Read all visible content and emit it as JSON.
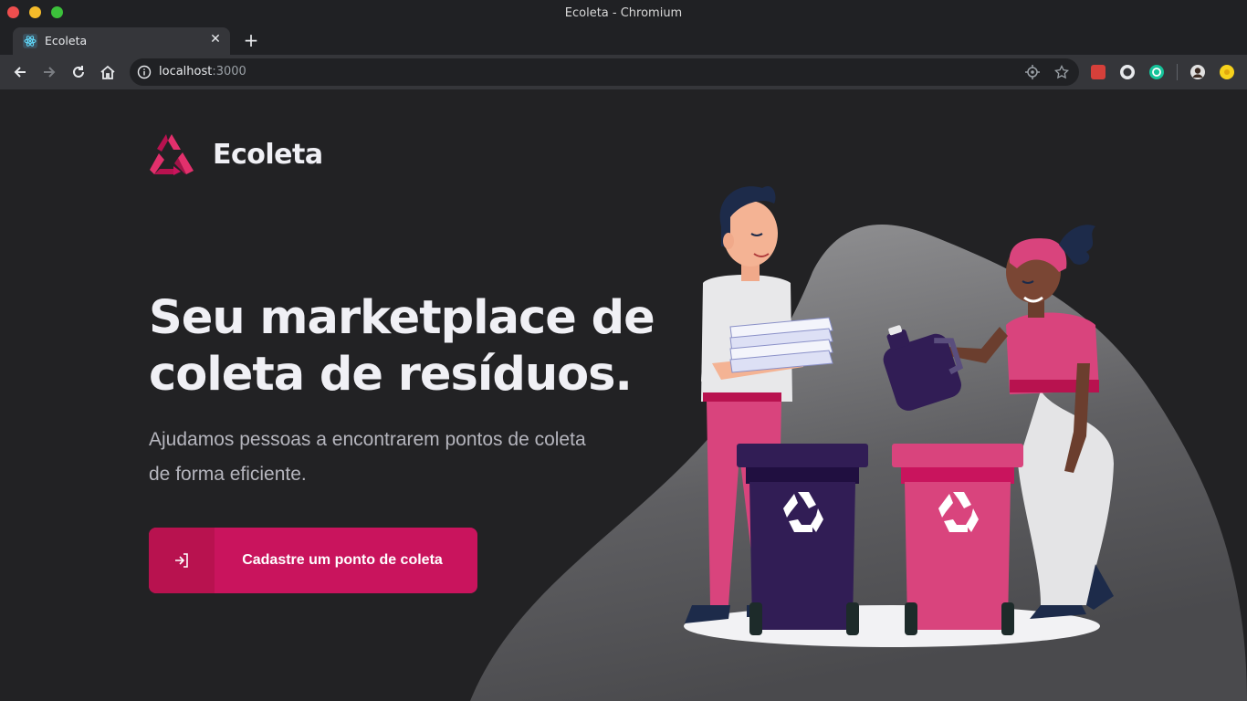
{
  "window": {
    "title": "Ecoleta - Chromium"
  },
  "tab": {
    "title": "Ecoleta",
    "favicon": "react-icon"
  },
  "toolbar": {
    "url_host": "localhost",
    "url_port": ":3000"
  },
  "page": {
    "brand": "Ecoleta",
    "headline_line1": "Seu marketplace de",
    "headline_line2": "coleta de resíduos.",
    "subline_line1": "Ajudamos pessoas a encontrarem pontos de coleta",
    "subline_line2": "de forma eficiente.",
    "cta_label": "Cadastre um ponto de coleta"
  },
  "colors": {
    "background": "#222224",
    "brand_primary": "#c9145d",
    "brand_primary_dark": "#b8124f",
    "heading": "#f0f0f5",
    "body_text": "#b5b5bd"
  }
}
